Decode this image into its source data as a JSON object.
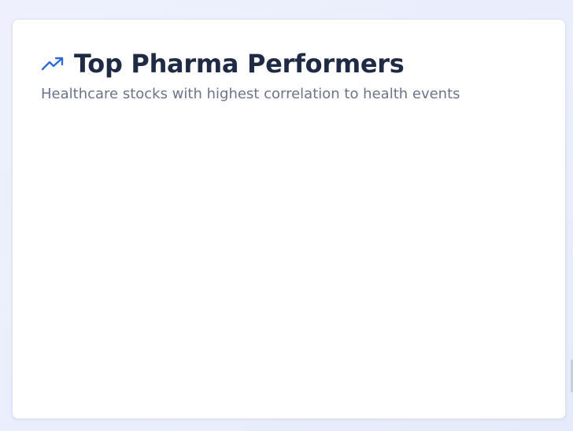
{
  "card": {
    "icon": "trending-up-icon",
    "title": "Top Pharma Performers",
    "subtitle": "Healthcare stocks with highest correlation to health events"
  },
  "colors": {
    "accent": "#2f6bd8",
    "title": "#1f2a44",
    "subtitle": "#6b7488",
    "card_background": "#ffffff",
    "page_background": "#e9edfc"
  }
}
